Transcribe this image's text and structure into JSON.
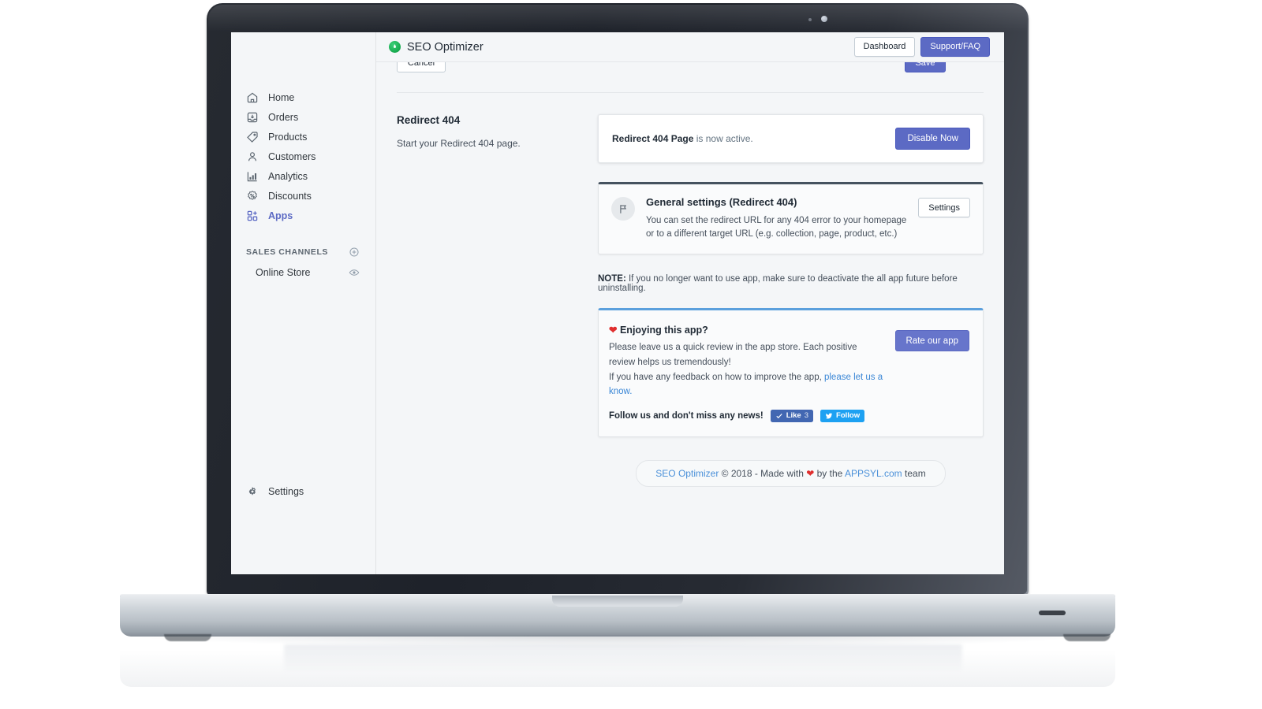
{
  "sidebar": {
    "items": [
      {
        "label": "Home",
        "icon": "home-icon",
        "active": false
      },
      {
        "label": "Orders",
        "icon": "orders-inbox-icon",
        "active": false
      },
      {
        "label": "Products",
        "icon": "tag-icon",
        "active": false
      },
      {
        "label": "Customers",
        "icon": "person-icon",
        "active": false
      },
      {
        "label": "Analytics",
        "icon": "bar-chart-icon",
        "active": false
      },
      {
        "label": "Discounts",
        "icon": "discount-badge-icon",
        "active": false
      },
      {
        "label": "Apps",
        "icon": "apps-grid-plus-icon",
        "active": true
      }
    ],
    "sales_channels_heading": "SALES CHANNELS",
    "add_channel_icon": "plus-circle-icon",
    "channels": [
      {
        "label": "Online Store",
        "icon": "storefront-icon",
        "action_icon": "eye-icon"
      }
    ],
    "settings": {
      "label": "Settings",
      "icon": "gear-icon"
    }
  },
  "topbar": {
    "app_name": "SEO Optimizer",
    "logo_icon": "green-leaf-badge-icon",
    "dashboard_label": "Dashboard",
    "support_label": "Support/FAQ"
  },
  "cutoff_buttons": {
    "cancel_label": "Cancel",
    "save_label": "Save"
  },
  "redirect_section": {
    "title": "Redirect 404",
    "description": "Start your Redirect 404 page.",
    "status_strong": "Redirect 404 Page",
    "status_rest": " is now active.",
    "disable_label": "Disable Now"
  },
  "general_settings_panel": {
    "icon": "flag-icon",
    "title": "General settings (Redirect 404)",
    "description": "You can set the redirect URL for any 404 error to your homepage or to a different target URL (e.g. collection, page, product, etc.)",
    "settings_label": "Settings"
  },
  "note": {
    "prefix": "NOTE:",
    "text": " If you no longer want to use app, make sure to deactivate the all app future before uninstalling."
  },
  "review_card": {
    "heart_icon": "heart-icon",
    "title": "Enjoying this app?",
    "line1": "Please leave us a quick review in the app store. Each positive review helps us tremendously!",
    "line2_prefix": "If you have any feedback on how to improve the app, ",
    "line2_link": "please let us a know.",
    "follow_label": "Follow us and don't miss any news!",
    "like_label": "Like",
    "like_count": "3",
    "like_icon": "facebook-thumb-check-icon",
    "follow_button_label": "Follow",
    "follow_icon": "twitter-bird-icon",
    "rate_label": "Rate our app"
  },
  "footer": {
    "app_link": "SEO Optimizer",
    "copyright": " © 2018 - Made with ",
    "heart_icon": "heart-icon",
    "by_the": " by the ",
    "company_link": "APPSYL.com",
    "team": " team"
  },
  "colors": {
    "accent_indigo": "#5c6ac4",
    "link_blue": "#3b87d6",
    "heart_red": "#e02f2f",
    "facebook_blue": "#4267b2",
    "twitter_blue": "#1da1f2",
    "panel_top_dark": "#45525f",
    "panel_top_blue": "#5ba0dd",
    "logo_green": "#16a94e"
  }
}
